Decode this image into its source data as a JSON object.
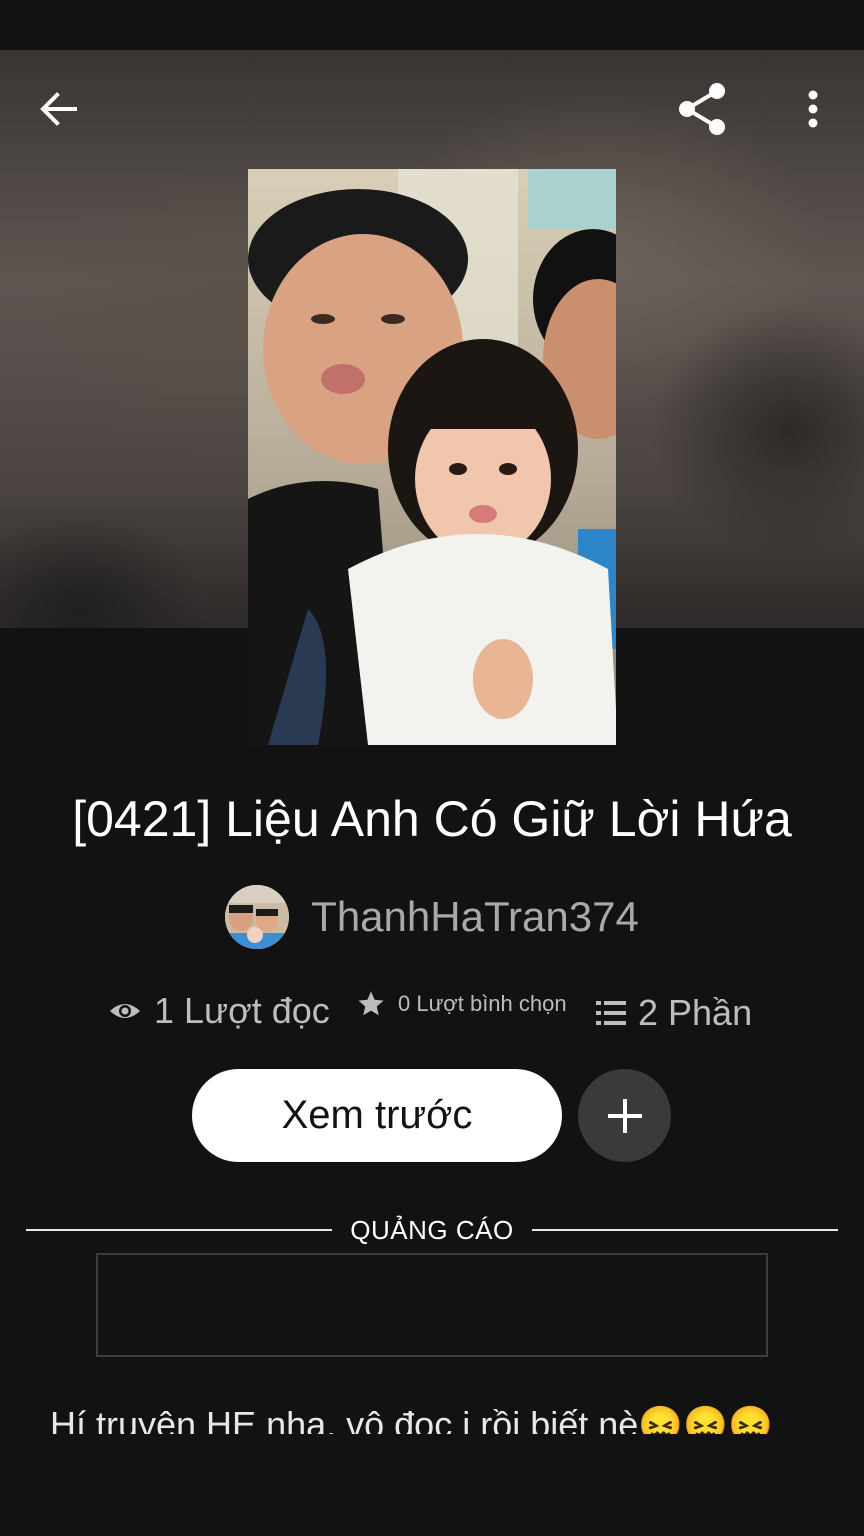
{
  "header": {
    "back_icon": "arrow-left-icon",
    "share_icon": "share-icon",
    "more_icon": "more-vertical-icon"
  },
  "story": {
    "title": "[0421] Liệu Anh Có Giữ Lời Hứa",
    "author": "ThanhHaTran374",
    "stats": {
      "reads": "1 Lượt đọc",
      "votes": "0 Lượt bình chọn",
      "parts": "2 Phần"
    },
    "description": "Hí truyện HE nha, vô đọc i rồi biết nè😖😖😖"
  },
  "actions": {
    "read_label": "Xem trước",
    "add_icon": "plus-icon"
  },
  "ad": {
    "label": "QUẢNG CÁO"
  },
  "colors": {
    "background": "#121212",
    "primary_button": "#ffffff",
    "secondary_button": "#3a3a3a",
    "muted_text": "#bdbdbd"
  }
}
